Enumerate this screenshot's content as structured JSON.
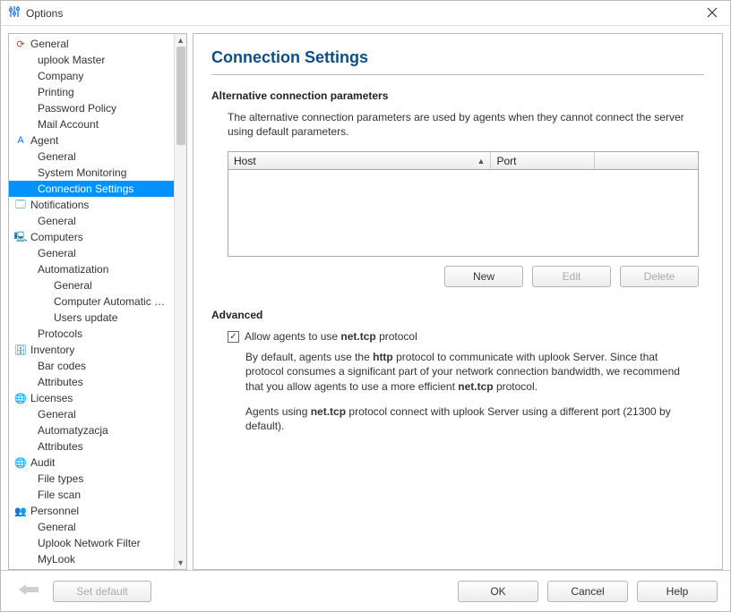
{
  "window": {
    "title": "Options"
  },
  "sidebar": {
    "groups": [
      {
        "icon": "⟳",
        "iconClass": "ic-red",
        "label": "General",
        "items": [
          "uplook Master",
          "Company",
          "Printing",
          "Password Policy",
          "Mail Account"
        ]
      },
      {
        "icon": "A",
        "iconClass": "ic-blue",
        "label": "Agent",
        "items": [
          "General",
          "System Monitoring",
          "Connection Settings"
        ],
        "selectedIndex": 2
      },
      {
        "icon": "🗔",
        "iconClass": "ic-teal",
        "label": "Notifications",
        "items": [
          "General"
        ]
      },
      {
        "icon": "🖳",
        "iconClass": "ic-teal",
        "label": "Computers",
        "items": [
          "General",
          "Automatization"
        ],
        "sub": {
          "parent": "Automatization",
          "items": [
            "General",
            "Computer Automatic C...",
            "Users update"
          ]
        },
        "tail": [
          "Protocols"
        ]
      },
      {
        "icon": "🗄",
        "iconClass": "ic-teal",
        "label": "Inventory",
        "items": [
          "Bar codes",
          "Attributes"
        ]
      },
      {
        "icon": "🌐",
        "iconClass": "ic-blue",
        "label": "Licenses",
        "items": [
          "General",
          "Automatyzacja",
          "Attributes"
        ]
      },
      {
        "icon": "🌐",
        "iconClass": "ic-blue",
        "label": "Audit",
        "items": [
          "File types",
          "File scan"
        ]
      },
      {
        "icon": "👥",
        "iconClass": "ic-dark",
        "label": "Personnel",
        "items": [
          "General",
          "Uplook Network Filter",
          "MyLook"
        ]
      }
    ]
  },
  "page": {
    "title": "Connection Settings",
    "alt": {
      "heading": "Alternative connection parameters",
      "desc": "The alternative connection parameters are used by agents when they cannot connect the server using default parameters.",
      "cols": {
        "host": "Host",
        "port": "Port"
      },
      "buttons": {
        "new": "New",
        "edit": "Edit",
        "delete": "Delete"
      }
    },
    "adv": {
      "heading": "Advanced",
      "checkbox_label_prefix": "Allow agents to use ",
      "checkbox_label_bold": "net.tcp",
      "checkbox_label_suffix": " protocol",
      "checked": true,
      "p1a": "By default, agents use the ",
      "p1b": "http",
      "p1c": " protocol to communicate with uplook Server. Since that protocol consumes a significant part of your network connection bandwidth, we recommend that you allow agents to use a more efficient ",
      "p1d": "net.tcp",
      "p1e": " protocol.",
      "p2a": "Agents using ",
      "p2b": "net.tcp",
      "p2c": " protocol connect with uplook Server using a different port (21300 by default)."
    }
  },
  "footer": {
    "set_default": "Set default",
    "ok": "OK",
    "cancel": "Cancel",
    "help": "Help"
  }
}
